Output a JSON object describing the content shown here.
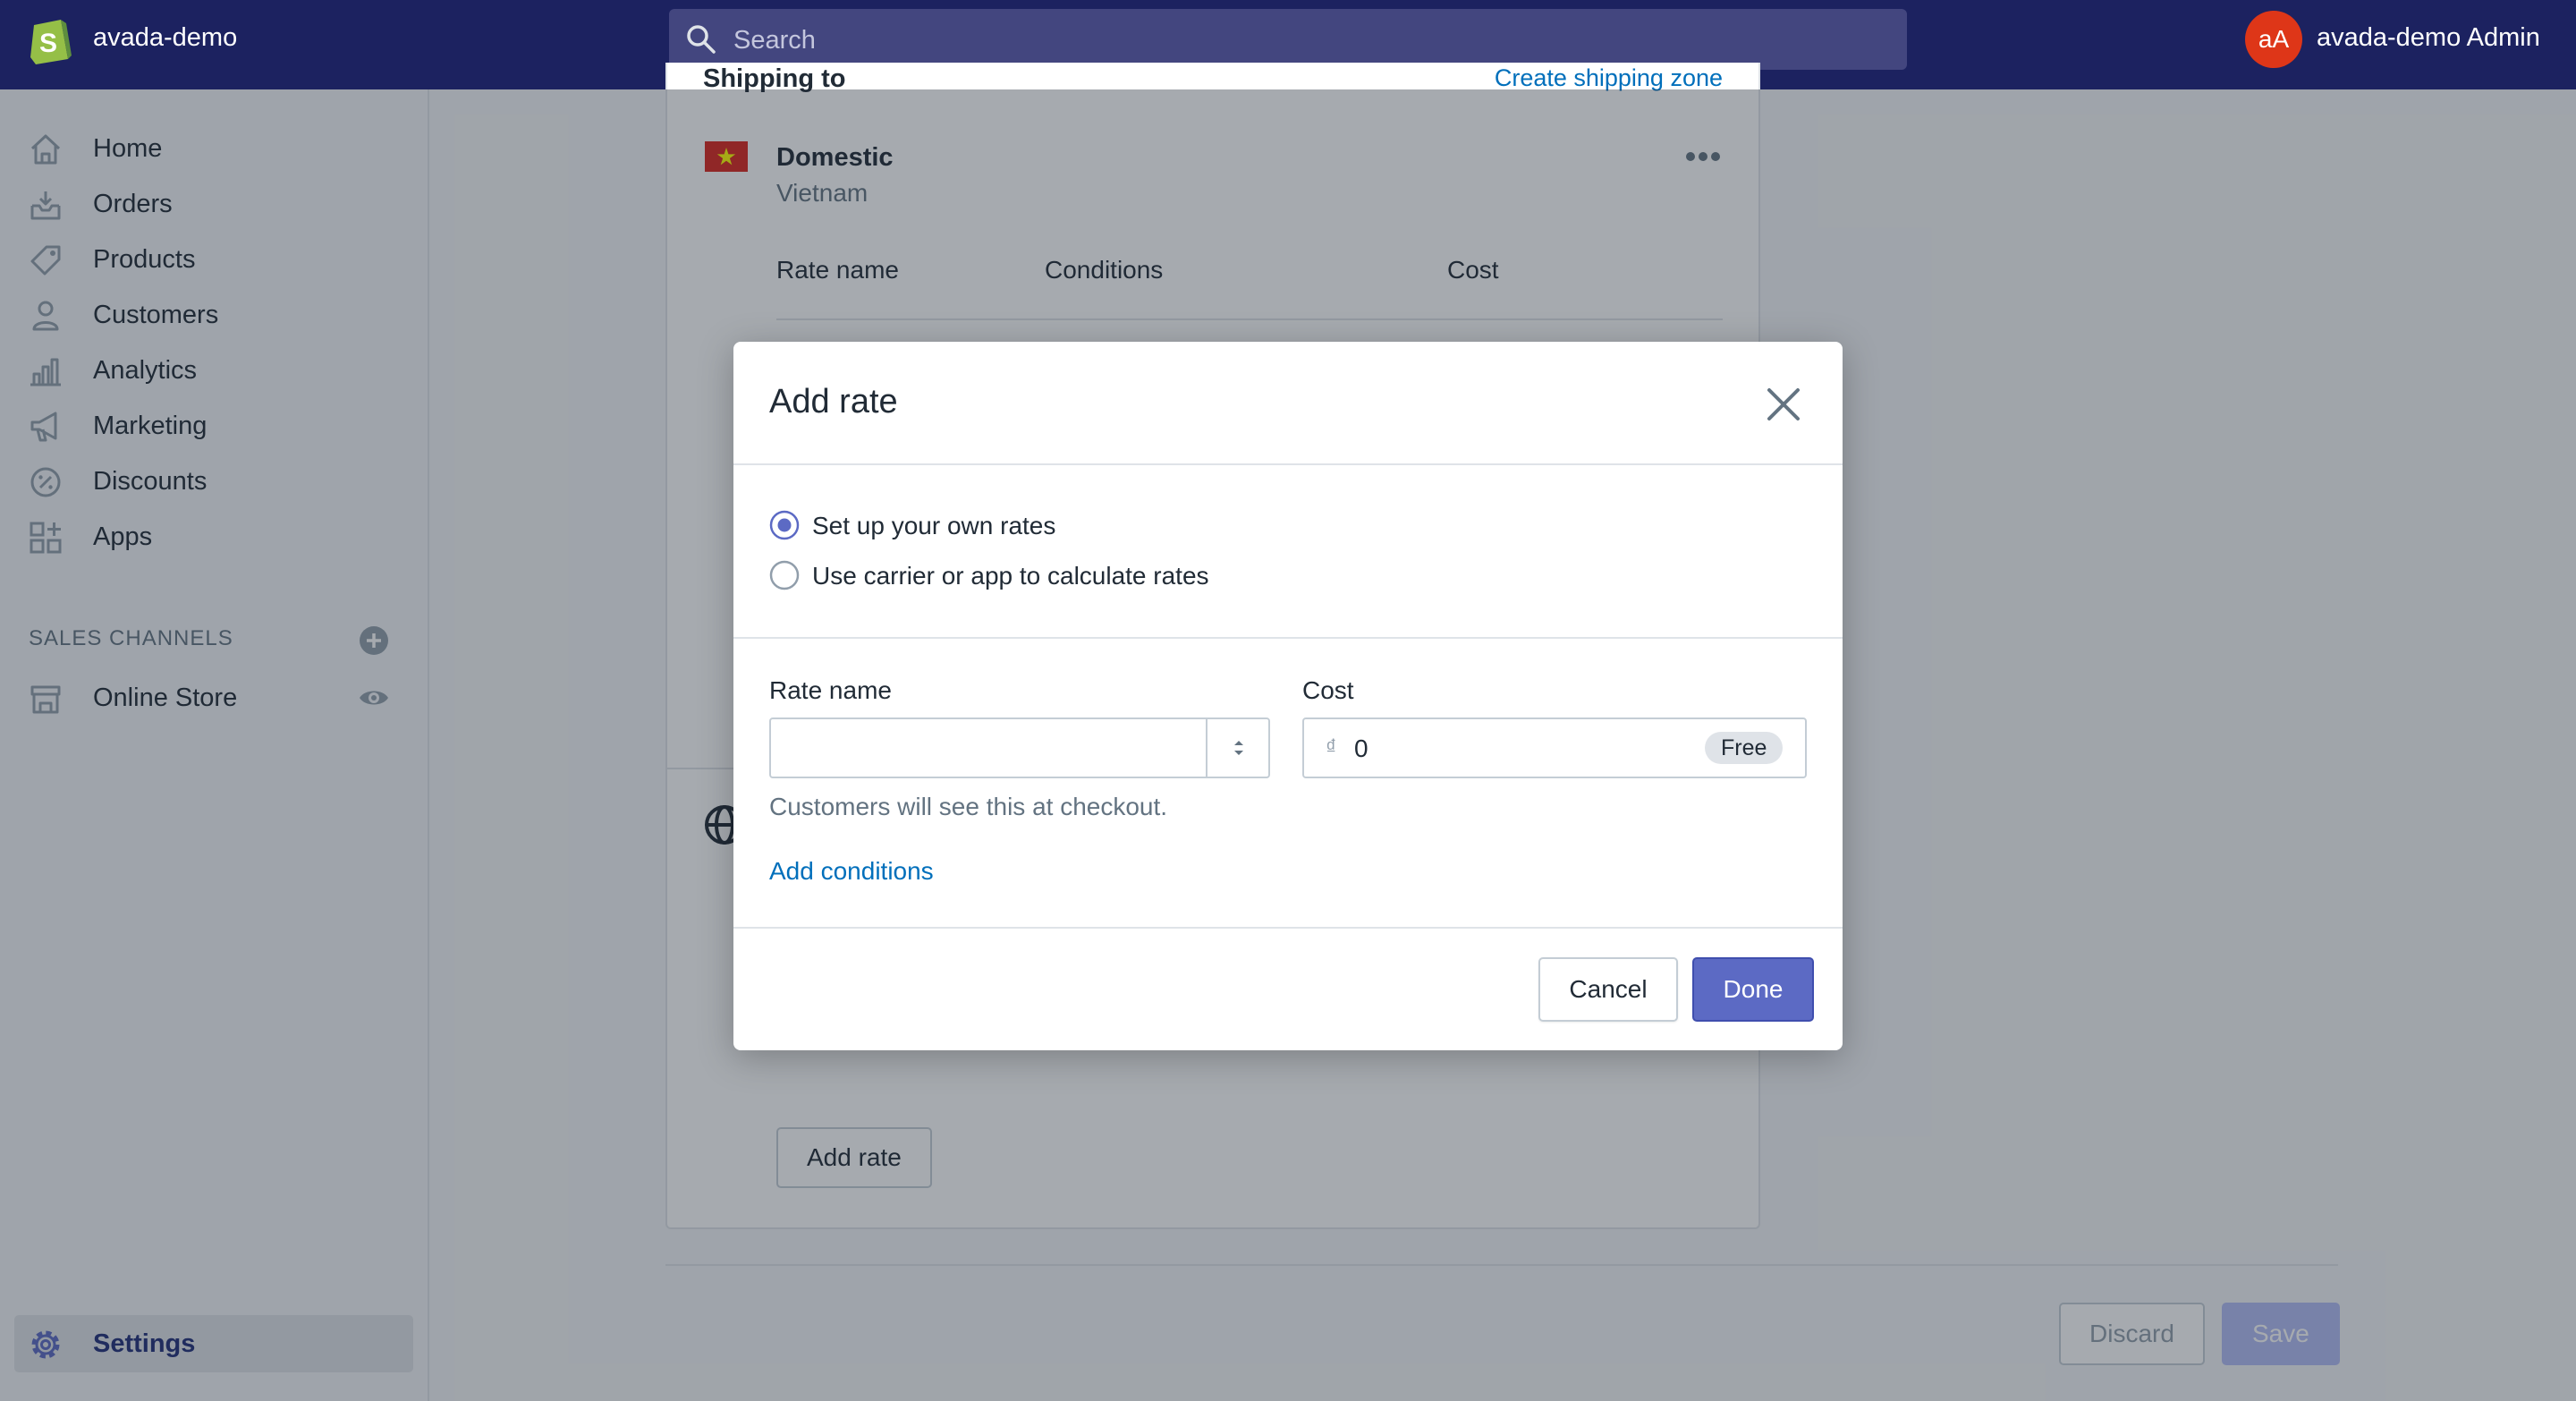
{
  "topbar": {
    "store_name": "avada-demo",
    "search_placeholder": "Search",
    "avatar_initials": "aA",
    "account_name": "avada-demo Admin"
  },
  "sidebar": {
    "items": [
      {
        "label": "Home",
        "icon": "home-icon"
      },
      {
        "label": "Orders",
        "icon": "orders-icon"
      },
      {
        "label": "Products",
        "icon": "tag-icon"
      },
      {
        "label": "Customers",
        "icon": "person-icon"
      },
      {
        "label": "Analytics",
        "icon": "bar-chart-icon"
      },
      {
        "label": "Marketing",
        "icon": "megaphone-icon"
      },
      {
        "label": "Discounts",
        "icon": "discount-icon"
      },
      {
        "label": "Apps",
        "icon": "apps-icon"
      }
    ],
    "sales_channels_title": "SALES CHANNELS",
    "online_store_label": "Online Store",
    "settings_label": "Settings"
  },
  "shipping": {
    "heading": "Shipping to",
    "create_zone_link": "Create shipping zone",
    "zone_name": "Domestic",
    "zone_country": "Vietnam",
    "columns": [
      "Rate name",
      "Conditions",
      "Cost"
    ],
    "add_rate_label": "Add rate"
  },
  "footer": {
    "discard_label": "Discard",
    "save_label": "Save"
  },
  "modal": {
    "title": "Add rate",
    "options": [
      {
        "label": "Set up your own rates",
        "selected": true
      },
      {
        "label": "Use carrier or app to calculate rates",
        "selected": false
      }
    ],
    "rate_name_label": "Rate name",
    "rate_name_value": "",
    "cost_label": "Cost",
    "currency_symbol": "₫",
    "cost_value": "0",
    "free_badge": "Free",
    "help_text": "Customers will see this at checkout.",
    "add_conditions_link": "Add conditions",
    "cancel_label": "Cancel",
    "done_label": "Done"
  },
  "colors": {
    "topbar": "#1c2260",
    "primary": "#5c6ac4",
    "link": "#006fbb",
    "avatar": "#de3618"
  }
}
